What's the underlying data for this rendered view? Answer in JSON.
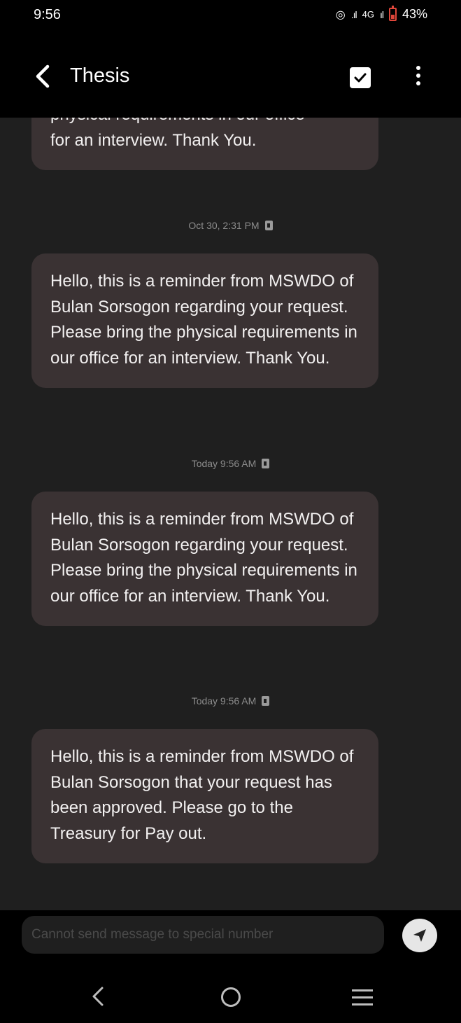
{
  "status_bar": {
    "time": "9:56",
    "signal_1": ".ıl",
    "network": "4G",
    "signal_2": "ıl",
    "battery": "43%"
  },
  "header": {
    "title": "Thesis"
  },
  "conversation": {
    "messages": [
      {
        "partial_top": "physical requirements in our office",
        "partial_bottom": "for an interview. Thank You."
      },
      {
        "timestamp": "Oct 30, 2:31 PM",
        "text": "Hello, this is a reminder from MSWDO of Bulan Sorsogon regarding your request. Please bring the physical requirements in our office for an interview. Thank You."
      },
      {
        "timestamp": "Today 9:56 AM",
        "text": "Hello, this is a reminder from MSWDO of Bulan Sorsogon regarding your request. Please bring the physical requirements in our office for an interview. Thank You."
      },
      {
        "timestamp": "Today 9:56 AM",
        "text": "Hello, this is a reminder from MSWDO of Bulan Sorsogon that your request has been approved. Please go to the Treasury for Pay out."
      }
    ]
  },
  "input": {
    "placeholder": "Cannot send message to special number"
  },
  "colors": {
    "bubble": "#3a3233",
    "conversation_bg": "#1f1f1f",
    "battery_accent": "#e0463a"
  }
}
